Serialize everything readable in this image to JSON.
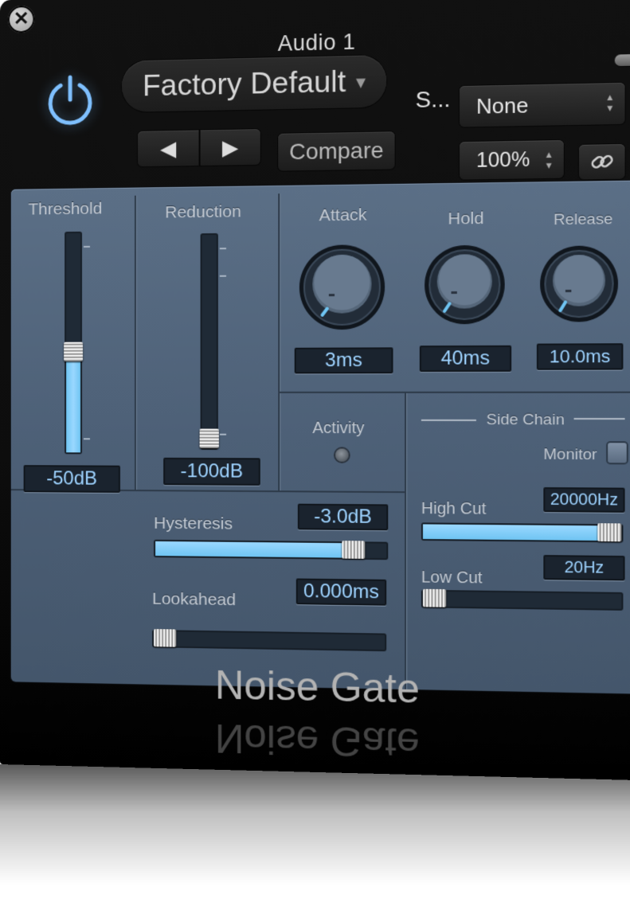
{
  "window": {
    "title": "Audio 1",
    "close_icon": "close-icon"
  },
  "header": {
    "preset": "Factory Default",
    "prev_arrow": "◀",
    "next_arrow": "▶",
    "compare_label": "Compare",
    "sidechain_label": "S...",
    "sidechain_value": "None",
    "zoom_value": "100%"
  },
  "controls": {
    "threshold": {
      "label": "Threshold",
      "value": "-50dB",
      "fill_fraction": 0.46
    },
    "reduction": {
      "label": "Reduction",
      "value": "-100dB",
      "fill_fraction": 0.0
    },
    "attack": {
      "label": "Attack",
      "value": "3ms"
    },
    "hold": {
      "label": "Hold",
      "value": "40ms"
    },
    "release": {
      "label": "Release",
      "value": "10.0ms"
    },
    "activity_label": "Activity",
    "hysteresis": {
      "label": "Hysteresis",
      "value": "-3.0dB",
      "fill_fraction": 0.86
    },
    "lookahead": {
      "label": "Lookahead",
      "value": "0.000ms",
      "fill_fraction": 0.03
    }
  },
  "side_chain": {
    "title": "Side Chain",
    "monitor_label": "Monitor",
    "high_cut": {
      "label": "High Cut",
      "value": "20000Hz",
      "fill_fraction": 0.97
    },
    "low_cut": {
      "label": "Low Cut",
      "value": "20Hz",
      "fill_fraction": 0.02
    }
  },
  "plugin_name": "Noise Gate",
  "colors": {
    "accent": "#9ed3ff",
    "panel": "#4d6077",
    "power": "#7fc0ff"
  }
}
